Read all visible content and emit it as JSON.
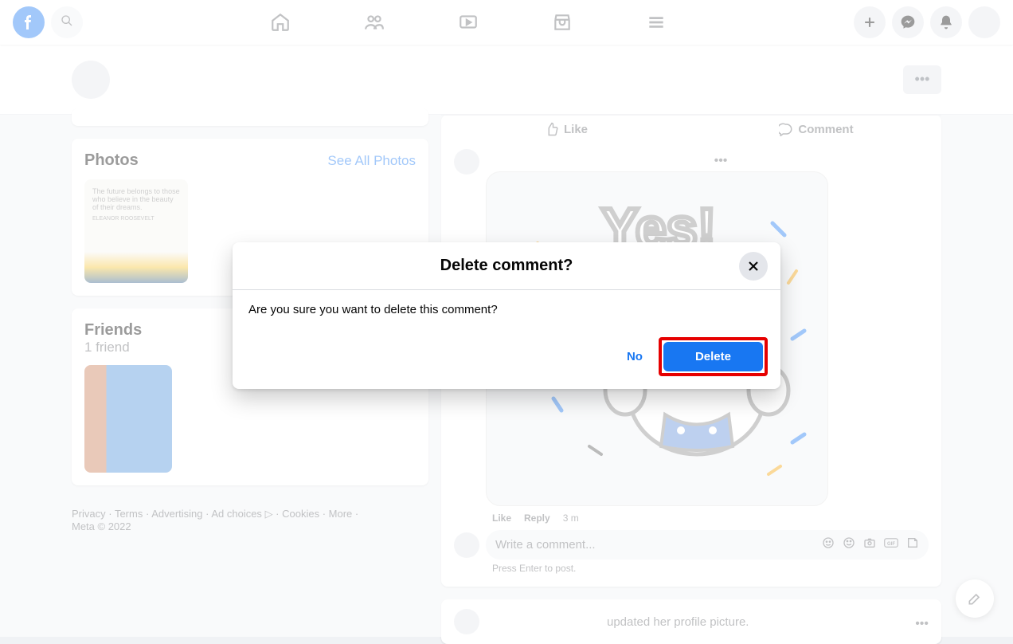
{
  "nav": {
    "search_label": "Search",
    "home": "Home",
    "friends": "Friends",
    "watch": "Watch",
    "marketplace": "Marketplace",
    "menu": "Menu"
  },
  "sidebar": {
    "photos": {
      "title": "Photos",
      "link": "See All Photos",
      "quote": "The future belongs to those who believe in the beauty of their dreams.",
      "attrib": "ELEANOR ROOSEVELT"
    },
    "friends": {
      "title": "Friends",
      "count": "1 friend"
    }
  },
  "post": {
    "like": "Like",
    "comment": "Comment",
    "meta": {
      "like": "Like",
      "reply": "Reply",
      "time": "3 m"
    },
    "input_placeholder": "Write a comment...",
    "enter_hint": "Press Enter to post.",
    "next_post_text": "updated her profile picture."
  },
  "footer": {
    "privacy": "Privacy",
    "terms": "Terms",
    "advertising": "Advertising",
    "adchoices": "Ad choices",
    "cookies": "Cookies",
    "more": "More",
    "meta": "Meta © 2022"
  },
  "modal": {
    "title": "Delete comment?",
    "body": "Are you sure you want to delete this comment?",
    "no": "No",
    "delete": "Delete"
  }
}
